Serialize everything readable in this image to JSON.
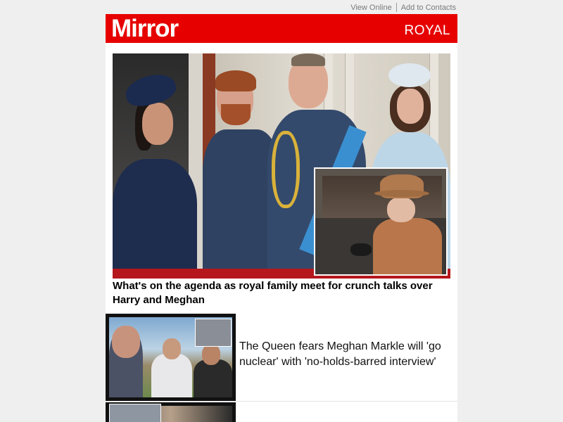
{
  "topbar": {
    "view_online": "View Online",
    "add_to_contacts": "Add to Contacts"
  },
  "masthead": {
    "logo": "Mirror",
    "section": "ROYAL",
    "brand_color": "#e60000"
  },
  "hero": {
    "headline": "What's on the agenda as royal family meet for crunch talks over Harry and Meghan"
  },
  "stories": [
    {
      "text": "The Queen fears Meghan Markle will 'go nuclear' with 'no-holds-barred interview'"
    }
  ],
  "icons": {
    "separator": "divider"
  }
}
